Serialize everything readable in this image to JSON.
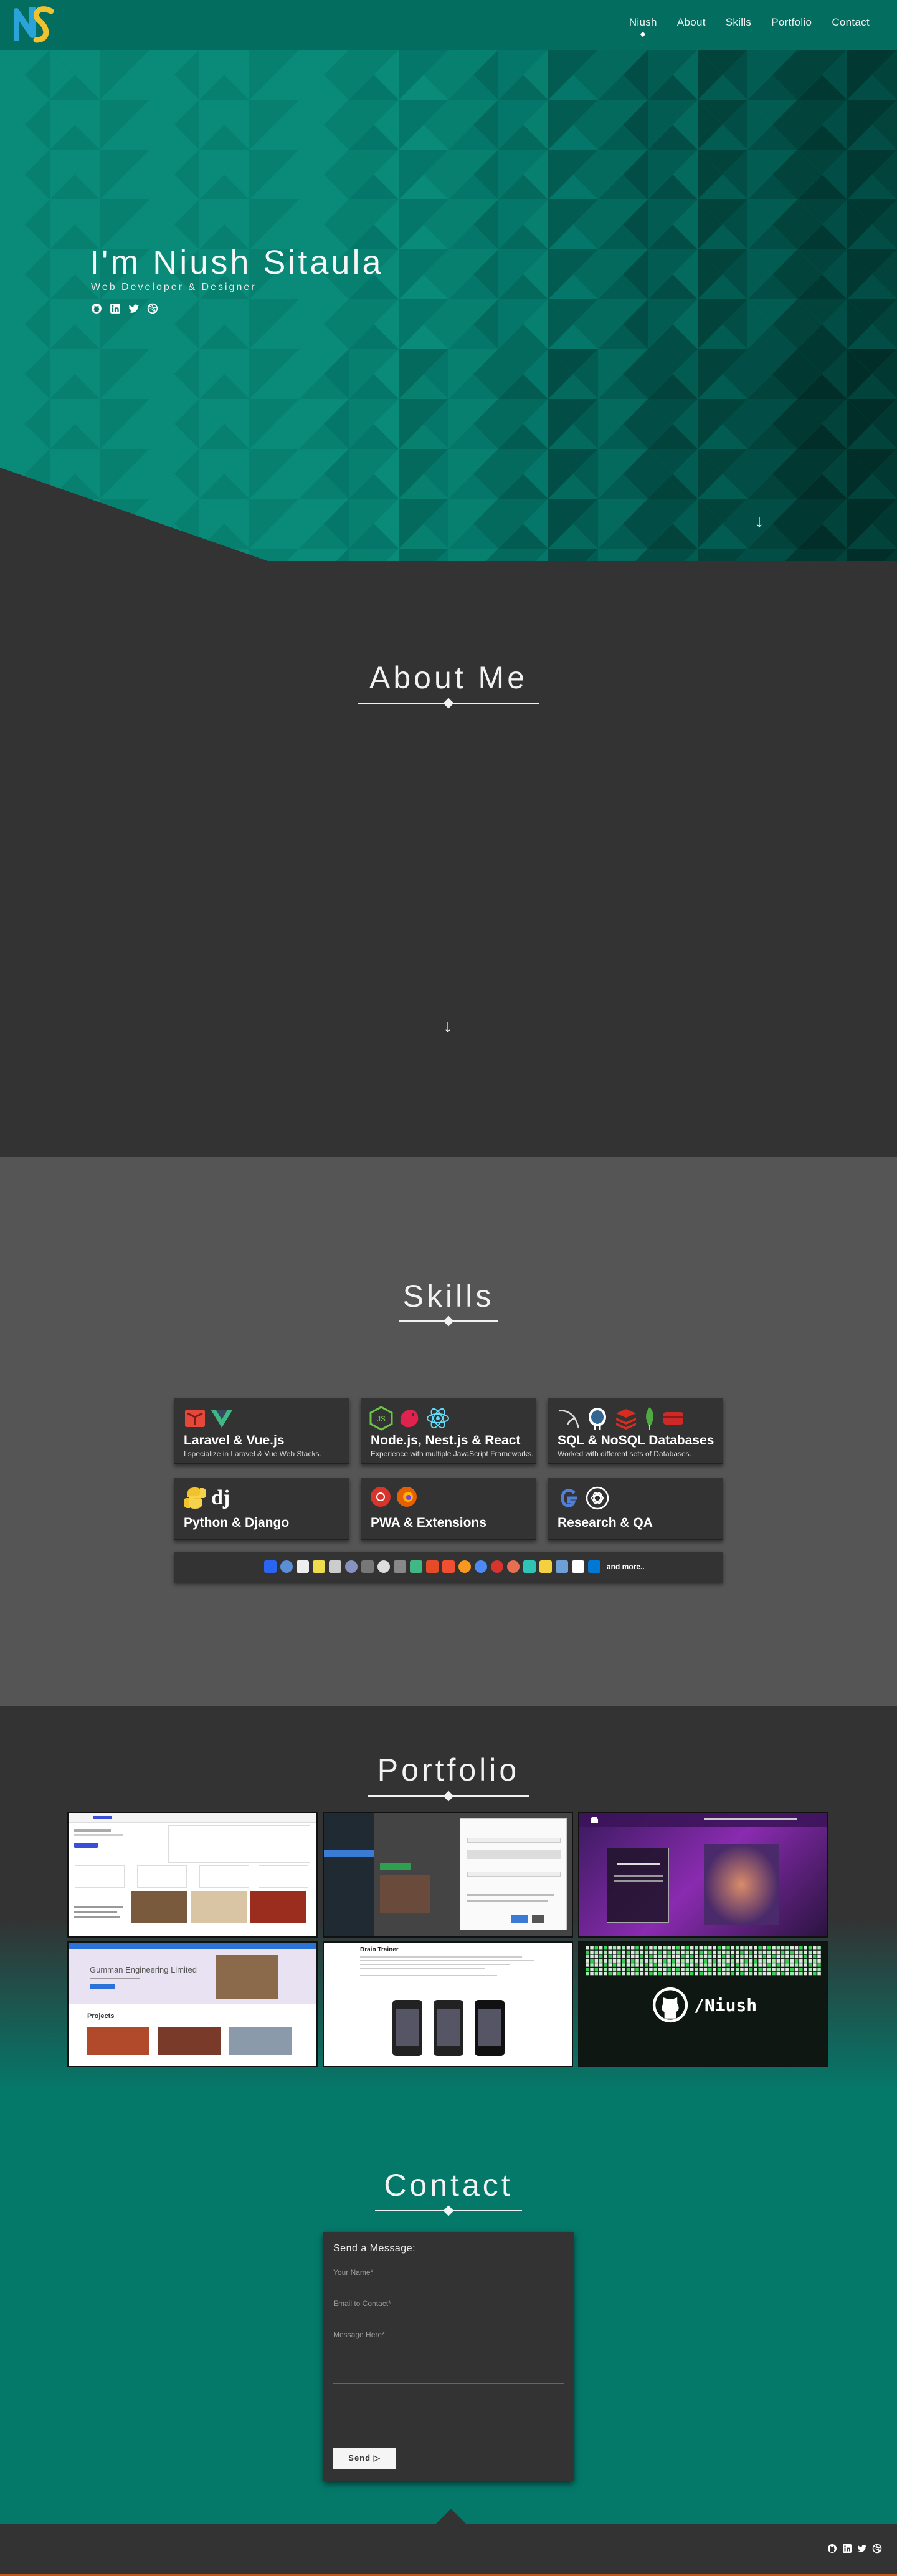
{
  "nav": {
    "brand": "NS",
    "items": [
      "Niush",
      "About",
      "Skills",
      "Portfolio",
      "Contact"
    ],
    "active": "Niush"
  },
  "hero": {
    "name": "I'm Niush Sitaula",
    "role": "Web Developer & Designer",
    "social_icons": [
      "github-icon",
      "linkedin-icon",
      "twitter-icon",
      "dribbble-icon"
    ],
    "scroll_icon": "arrow-down-icon"
  },
  "about": {
    "title": "About Me",
    "scroll_icon": "arrow-down-icon"
  },
  "skills": {
    "title": "Skills",
    "cards": [
      {
        "title": "Laravel & Vue.js",
        "desc": "I specialize in Laravel & Vue Web Stacks.",
        "icons": [
          "laravel-icon",
          "vue-icon"
        ]
      },
      {
        "title": "Node.js, Nest.js & React",
        "desc": "Experience with multiple JavaScript Frameworks.",
        "icons": [
          "nodejs-icon",
          "nestjs-icon",
          "react-icon"
        ]
      },
      {
        "title": "SQL & NoSQL Databases",
        "desc": "Worked with different sets of Databases.",
        "icons": [
          "mysql-icon",
          "postgresql-icon",
          "redis-icon",
          "mongodb-icon",
          "database-icon"
        ]
      },
      {
        "title": "Python & Django",
        "desc": "",
        "icons": [
          "python-icon",
          "django-icon"
        ]
      },
      {
        "title": "PWA & Extensions",
        "desc": "",
        "icons": [
          "chrome-icon",
          "firefox-icon"
        ]
      },
      {
        "title": "Research & QA",
        "desc": "",
        "icons": [
          "google-icon",
          "openai-icon"
        ]
      }
    ],
    "tools_more": "and more.."
  },
  "portfolio": {
    "title": "Portfolio",
    "items": [
      {
        "name": "dashboard-app"
      },
      {
        "name": "admin-modal-app"
      },
      {
        "name": "music-event-site"
      },
      {
        "name": "engineering-site",
        "heading": "Gumman Engineering Limited",
        "sub": "Projects"
      },
      {
        "name": "brain-trainer",
        "heading": "Brain Trainer"
      },
      {
        "name": "github-profile",
        "heading": "/Niush"
      }
    ]
  },
  "contact": {
    "title": "Contact",
    "form_heading": "Send a Message:",
    "name_placeholder": "Your Name*",
    "email_placeholder": "Email to Contact*",
    "message_placeholder": "Message Here*",
    "send_label": "Send"
  },
  "colors": {
    "teal": "#04796a",
    "dark": "#333333",
    "mid": "#555555",
    "accent_footer": "#c05a1a"
  }
}
